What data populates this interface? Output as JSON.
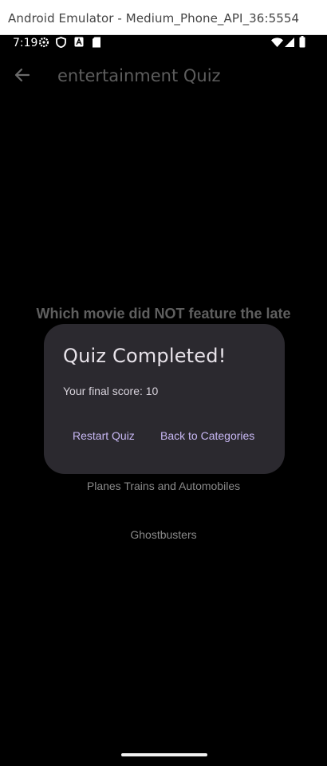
{
  "window": {
    "title": "Android Emulator - Medium_Phone_API_36:5554"
  },
  "status_bar": {
    "time": "7:19",
    "icons": [
      "settings-icon",
      "shield-icon",
      "font-a-icon",
      "sd-card-icon",
      "wifi-icon",
      "signal-icon",
      "battery-icon"
    ]
  },
  "app_bar": {
    "title": "entertainment Quiz",
    "back_icon": "arrow-back-icon"
  },
  "question": {
    "text": "Which movie did NOT feature the late"
  },
  "answers": [
    "Planes Trains and Automobiles",
    "Ghostbusters"
  ],
  "dialog": {
    "title": "Quiz Completed!",
    "message": "Your final score: 10",
    "restart_label": "Restart Quiz",
    "back_label": "Back to Categories"
  },
  "colors": {
    "background": "#000000",
    "dialog": "#2b292f",
    "accent": "#c7b7f3"
  }
}
